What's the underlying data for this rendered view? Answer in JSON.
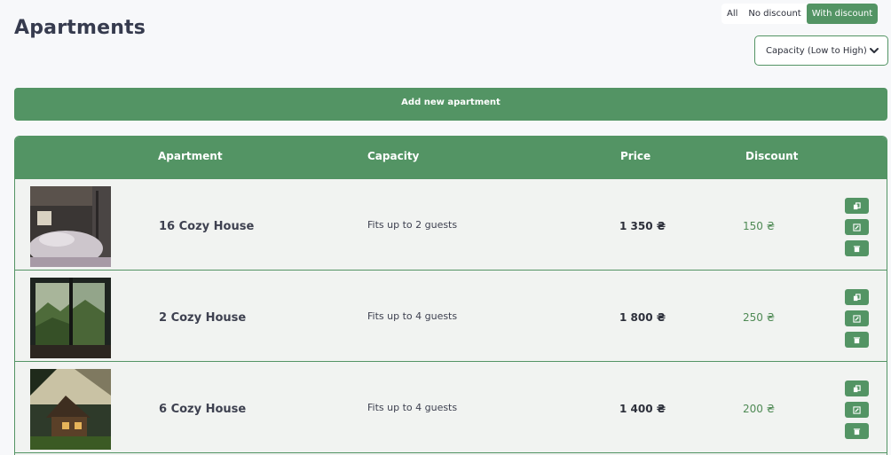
{
  "page": {
    "title": "Apartments"
  },
  "filters": {
    "options": [
      "All",
      "No discount",
      "With discount"
    ],
    "active": "With discount"
  },
  "sort": {
    "selected": "Capacity (Low to High)",
    "icon": "chevron-down-icon"
  },
  "add_button": {
    "label": "Add new apartment"
  },
  "table": {
    "headers": {
      "apartment": "Apartment",
      "capacity": "Capacity",
      "price": "Price",
      "discount": "Discount"
    },
    "rows": [
      {
        "name": "16 Cozy House",
        "capacity": "Fits up to 2 guests",
        "price": "1 350 ₴",
        "discount": "150 ₴",
        "image": "bedroom-photo"
      },
      {
        "name": "2 Cozy House",
        "capacity": "Fits up to 4 guests",
        "price": "1 800 ₴",
        "discount": "250 ₴",
        "image": "mountain-window-photo"
      },
      {
        "name": "6 Cozy House",
        "capacity": "Fits up to 4 guests",
        "price": "1 400 ₴",
        "discount": "200 ₴",
        "image": "cabin-photo"
      }
    ],
    "row_actions": [
      "copy-icon",
      "edit-icon",
      "trash-icon"
    ]
  },
  "colors": {
    "accent": "#539464",
    "background": "#f7f8fa",
    "discount_text": "#4f8a55"
  }
}
